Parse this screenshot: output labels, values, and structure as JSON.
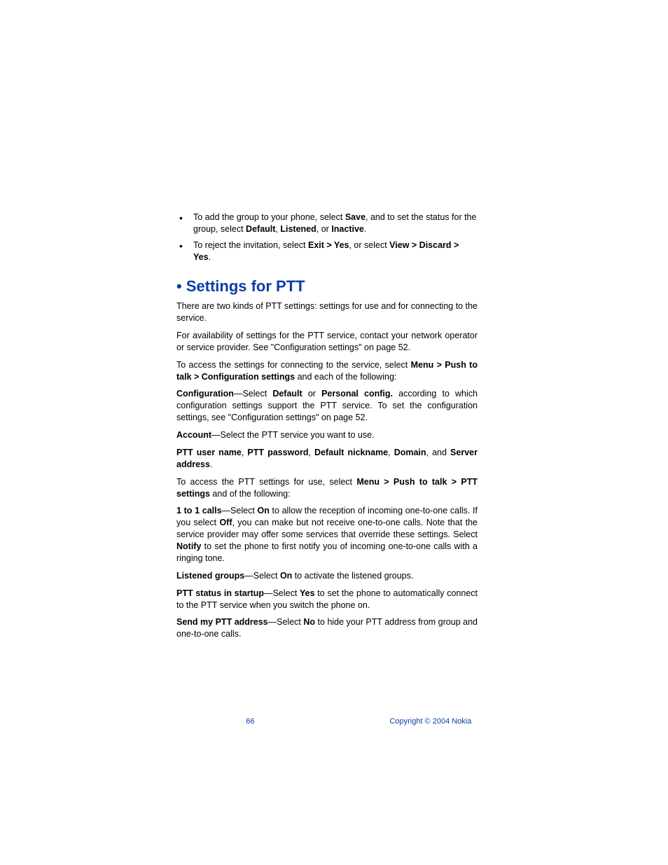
{
  "bullets": [
    {
      "pre": "To add the group to your phone, select ",
      "b1": "Save",
      "mid1": ", and to set the status for the group, select ",
      "b2": "Default",
      "sep1": ", ",
      "b3": "Listened",
      "sep2": ", or ",
      "b4": "Inactive",
      "post": "."
    },
    {
      "pre": "To reject the invitation, select ",
      "b1": "Exit > Yes",
      "mid1": ", or select ",
      "b2": "View > Discard > Yes",
      "post": "."
    }
  ],
  "heading": "Settings for PTT",
  "p1": "There are two kinds of PTT settings: settings for use and for connecting to the service.",
  "p2": "For availability of settings for the PTT service, contact your network operator or service provider. See \"Configuration settings\" on page 52.",
  "p3": {
    "pre": "To access the settings for connecting to the service, select ",
    "b1": "Menu > Push to talk > Configuration settings",
    "post": " and each of the following:"
  },
  "p4": {
    "b1": "Configuration",
    "t1": "—Select ",
    "b2": "Default",
    "t2": " or ",
    "b3": "Personal config.",
    "t3": " according to which configuration settings support the PTT service. To set the configuration settings, see \"Configuration settings\" on page 52."
  },
  "p5": {
    "b1": "Account",
    "t1": "—Select the PTT service you want to use."
  },
  "p6": {
    "b1": "PTT user name",
    "s1": ", ",
    "b2": "PTT password",
    "s2": ", ",
    "b3": "Default nickname",
    "s3": ", ",
    "b4": "Domain",
    "s4": ", and ",
    "b5": "Server address",
    "s5": "."
  },
  "p7": {
    "pre": "To access the PTT settings for use, select ",
    "b1": "Menu > Push to talk > PTT settings",
    "post": " and of the following:"
  },
  "p8": {
    "b1": "1 to 1 calls",
    "t1": "—Select ",
    "b2": "On",
    "t2": " to allow the reception of incoming one-to-one calls. If you select ",
    "b3": "Off",
    "t3": ", you can make but not receive one-to-one calls. Note that the service provider may offer some services that override these settings. Select ",
    "b4": "Notify",
    "t4": " to set the phone to first notify you of incoming one-to-one calls with a ringing tone."
  },
  "p9": {
    "b1": "Listened groups",
    "t1": "—Select ",
    "b2": "On",
    "t2": " to activate the listened groups."
  },
  "p10": {
    "b1": "PTT status in startup",
    "t1": "—Select ",
    "b2": "Yes",
    "t2": " to set the phone to automatically connect to the PTT service when you switch the phone on."
  },
  "p11": {
    "b1": "Send my PTT address",
    "t1": "—Select ",
    "b2": "No",
    "t2": " to hide your PTT address from group and one-to-one calls."
  },
  "footer": {
    "page": "66",
    "copyright": "Copyright © 2004 Nokia"
  }
}
